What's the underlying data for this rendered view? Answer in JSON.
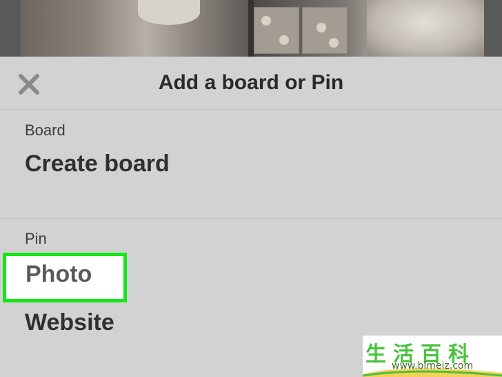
{
  "dialog": {
    "title": "Add a board or Pin",
    "close_icon": "close-icon"
  },
  "sections": {
    "board": {
      "label": "Board",
      "options": [
        "Create board"
      ]
    },
    "pin": {
      "label": "Pin",
      "options": [
        "Photo",
        "Website"
      ]
    }
  },
  "highlight_color": "#17e617",
  "watermark": {
    "characters": "生活百科",
    "url": "www.bimeiz.com"
  }
}
